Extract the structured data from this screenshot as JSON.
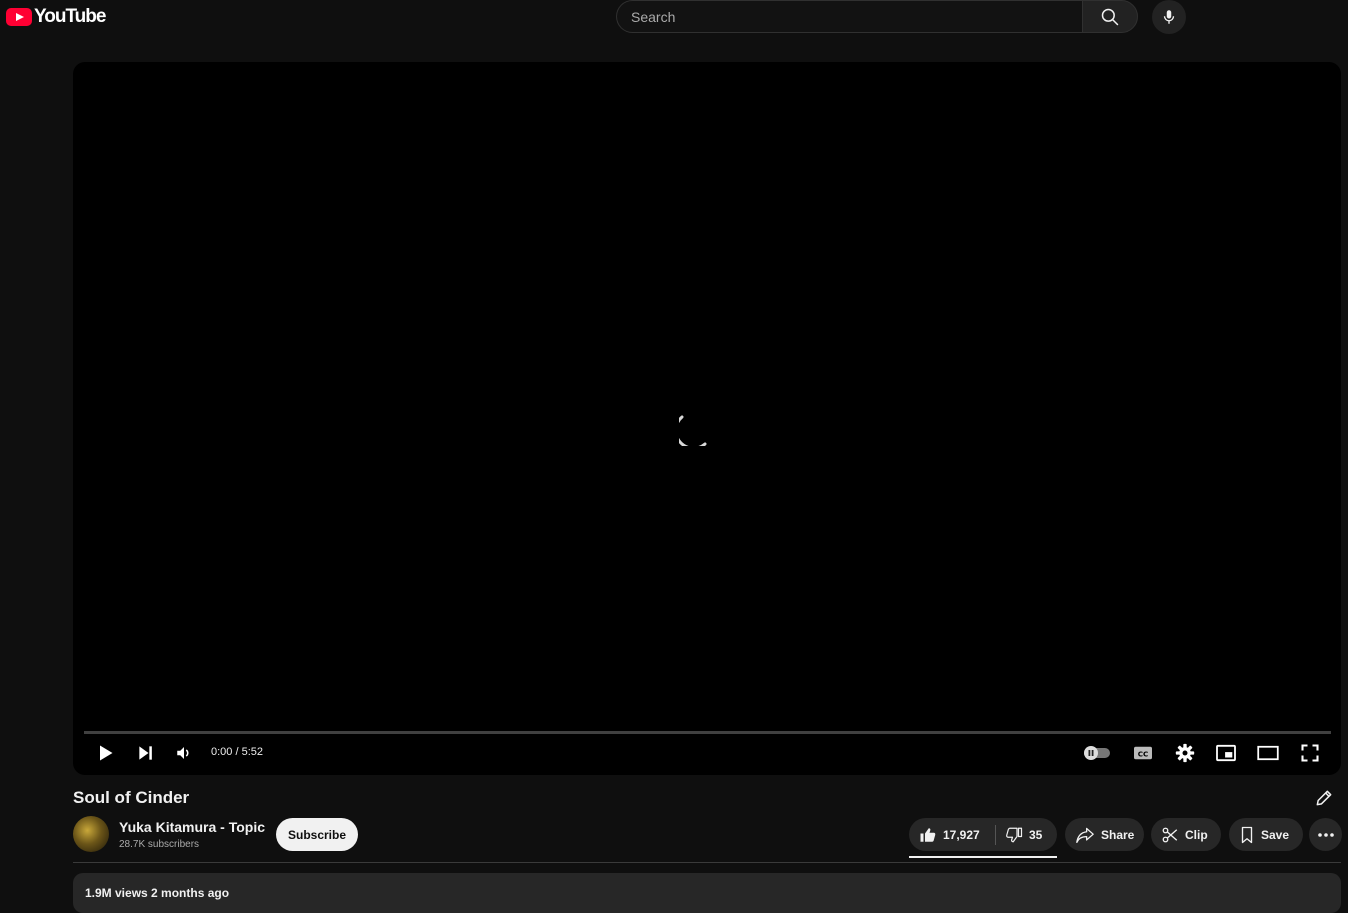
{
  "header": {
    "logo_text": "YouTube",
    "search_placeholder": "Search"
  },
  "player": {
    "time_display": "0:00 / 5:52",
    "progress_fraction": 0,
    "state": "loading"
  },
  "video": {
    "title": "Soul of Cinder"
  },
  "channel": {
    "name": "Yuka Kitamura - Topic",
    "subscribers": "28.7K subscribers",
    "subscribe_label": "Subscribe"
  },
  "actions": {
    "likes": "17,927",
    "dislikes": "35",
    "share_label": "Share",
    "clip_label": "Clip",
    "save_label": "Save"
  },
  "description": {
    "meta": "1.9M views  2 months ago"
  },
  "colors": {
    "brand_red": "#ff0033",
    "background": "#0f0f0f",
    "pill_bg": "#272727"
  }
}
